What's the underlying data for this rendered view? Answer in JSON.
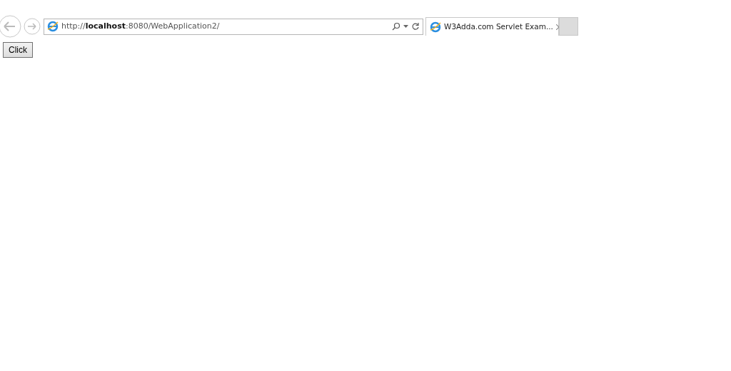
{
  "address_bar": {
    "url": "http://**localhost**:8080/WebApplication2/"
  },
  "tabs": [
    {
      "title": "W3Adda.com Servlet Exam...",
      "selected": true
    }
  ],
  "page": {
    "button": "Click"
  }
}
